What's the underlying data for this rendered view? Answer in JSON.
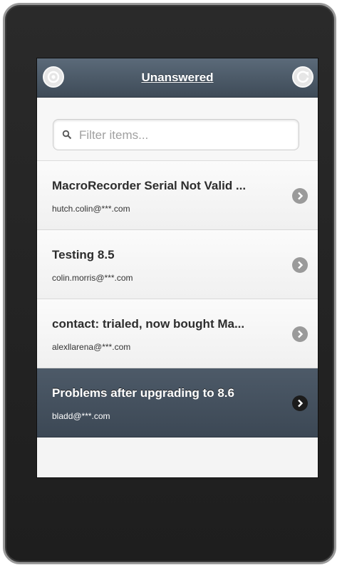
{
  "header": {
    "title": "Unanswered"
  },
  "search": {
    "placeholder": "Filter items..."
  },
  "items": [
    {
      "subject": "MacroRecorder Serial Not Valid ...",
      "email": "hutch.colin@***.com"
    },
    {
      "subject": "Testing 8.5",
      "email": "colin.morris@***.com"
    },
    {
      "subject": "contact: trialed, now bought Ma...",
      "email": "alexllarena@***.com"
    },
    {
      "subject": "Problems after upgrading to 8.6",
      "email": "bladd@***.com"
    }
  ],
  "colors": {
    "header_bar": "#4a5866",
    "active_item": "#44505d",
    "list_bg": "#f4f4f4"
  }
}
